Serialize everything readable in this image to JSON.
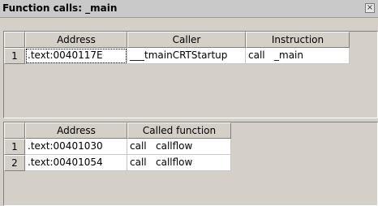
{
  "window": {
    "title": "Function calls: _main",
    "close_glyph": "×"
  },
  "callers": {
    "headers": [
      "Address",
      "Caller",
      "Instruction"
    ],
    "rows": [
      {
        "num": "1",
        "address": ".text:0040117E",
        "caller": "___tmainCRTStartup",
        "op": "call",
        "target": "_main"
      }
    ]
  },
  "callees": {
    "headers": [
      "Address",
      "Called function"
    ],
    "rows": [
      {
        "num": "1",
        "address": ".text:00401030",
        "op": "call",
        "target": "callflow"
      },
      {
        "num": "2",
        "address": ".text:00401054",
        "op": "call",
        "target": "callflow"
      }
    ]
  }
}
